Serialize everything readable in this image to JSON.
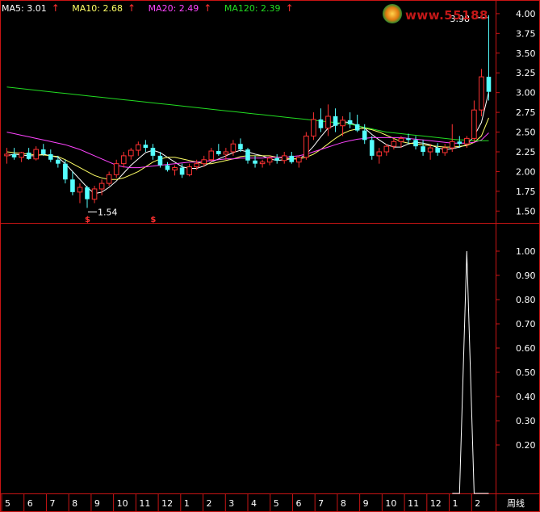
{
  "legend": {
    "ma5": {
      "label": "MA5: 3.01",
      "color": "#ffffff"
    },
    "ma10": {
      "label": "MA10: 2.68",
      "color": "#ffff66"
    },
    "ma20": {
      "label": "MA20: 2.49",
      "color": "#ff44ff"
    },
    "ma120": {
      "label": "MA120: 2.39",
      "color": "#22dd22"
    },
    "arrow": "↑"
  },
  "watermark": {
    "text": "www.55188"
  },
  "annotations": {
    "high": "3.98",
    "low": "1.54",
    "signal_marks": [
      "$",
      "$"
    ]
  },
  "period_label": "周线",
  "chart_data": [
    {
      "type": "candlestick",
      "name": "weekly-kline",
      "ylim": [
        1.35,
        4.05
      ],
      "yticks": [
        "1.50",
        "1.75",
        "2.00",
        "2.25",
        "2.50",
        "2.75",
        "3.00",
        "3.25",
        "3.50",
        "3.75",
        "4.00"
      ],
      "candles_ohlc": [
        [
          2.2,
          2.3,
          2.1,
          2.22
        ],
        [
          2.22,
          2.3,
          2.15,
          2.18
        ],
        [
          2.18,
          2.25,
          2.12,
          2.24
        ],
        [
          2.24,
          2.3,
          2.15,
          2.16
        ],
        [
          2.16,
          2.32,
          2.14,
          2.28
        ],
        [
          2.28,
          2.35,
          2.2,
          2.22
        ],
        [
          2.22,
          2.28,
          2.12,
          2.15
        ],
        [
          2.15,
          2.2,
          2.05,
          2.1
        ],
        [
          2.1,
          2.15,
          1.85,
          1.9
        ],
        [
          1.9,
          2.0,
          1.7,
          1.74
        ],
        [
          1.74,
          1.85,
          1.6,
          1.8
        ],
        [
          1.8,
          1.82,
          1.54,
          1.65
        ],
        [
          1.65,
          1.82,
          1.6,
          1.78
        ],
        [
          1.78,
          1.9,
          1.7,
          1.85
        ],
        [
          1.85,
          2.0,
          1.82,
          1.96
        ],
        [
          1.96,
          2.15,
          1.92,
          2.1
        ],
        [
          2.1,
          2.25,
          2.05,
          2.2
        ],
        [
          2.2,
          2.3,
          2.15,
          2.27
        ],
        [
          2.27,
          2.38,
          2.2,
          2.34
        ],
        [
          2.34,
          2.4,
          2.25,
          2.3
        ],
        [
          2.3,
          2.35,
          2.15,
          2.2
        ],
        [
          2.2,
          2.25,
          2.05,
          2.08
        ],
        [
          2.08,
          2.12,
          2.0,
          2.02
        ],
        [
          2.02,
          2.08,
          1.95,
          2.05
        ],
        [
          2.05,
          2.1,
          1.92,
          1.96
        ],
        [
          1.96,
          2.1,
          1.94,
          2.06
        ],
        [
          2.06,
          2.15,
          2.02,
          2.1
        ],
        [
          2.1,
          2.2,
          2.06,
          2.15
        ],
        [
          2.15,
          2.3,
          2.12,
          2.26
        ],
        [
          2.26,
          2.35,
          2.2,
          2.22
        ],
        [
          2.22,
          2.3,
          2.15,
          2.25
        ],
        [
          2.25,
          2.4,
          2.2,
          2.35
        ],
        [
          2.35,
          2.42,
          2.25,
          2.28
        ],
        [
          2.28,
          2.3,
          2.1,
          2.14
        ],
        [
          2.14,
          2.2,
          2.05,
          2.1
        ],
        [
          2.1,
          2.15,
          2.05,
          2.12
        ],
        [
          2.12,
          2.2,
          2.08,
          2.17
        ],
        [
          2.17,
          2.22,
          2.1,
          2.14
        ],
        [
          2.14,
          2.25,
          2.1,
          2.2
        ],
        [
          2.2,
          2.25,
          2.1,
          2.12
        ],
        [
          2.12,
          2.2,
          2.05,
          2.18
        ],
        [
          2.18,
          2.5,
          2.15,
          2.45
        ],
        [
          2.45,
          2.75,
          2.4,
          2.66
        ],
        [
          2.66,
          2.8,
          2.5,
          2.55
        ],
        [
          2.55,
          2.85,
          2.45,
          2.7
        ],
        [
          2.7,
          2.8,
          2.5,
          2.58
        ],
        [
          2.58,
          2.7,
          2.45,
          2.65
        ],
        [
          2.65,
          2.75,
          2.55,
          2.6
        ],
        [
          2.6,
          2.72,
          2.5,
          2.52
        ],
        [
          2.52,
          2.6,
          2.35,
          2.4
        ],
        [
          2.4,
          2.45,
          2.15,
          2.2
        ],
        [
          2.2,
          2.3,
          2.1,
          2.25
        ],
        [
          2.25,
          2.35,
          2.2,
          2.32
        ],
        [
          2.32,
          2.42,
          2.28,
          2.38
        ],
        [
          2.38,
          2.45,
          2.3,
          2.42
        ],
        [
          2.42,
          2.48,
          2.35,
          2.4
        ],
        [
          2.4,
          2.45,
          2.28,
          2.32
        ],
        [
          2.32,
          2.4,
          2.2,
          2.25
        ],
        [
          2.25,
          2.35,
          2.15,
          2.3
        ],
        [
          2.3,
          2.36,
          2.2,
          2.24
        ],
        [
          2.24,
          2.35,
          2.2,
          2.3
        ],
        [
          2.3,
          2.6,
          2.25,
          2.38
        ],
        [
          2.38,
          2.45,
          2.3,
          2.35
        ],
        [
          2.35,
          2.45,
          2.3,
          2.42
        ],
        [
          2.42,
          2.9,
          2.38,
          2.78
        ],
        [
          2.78,
          3.3,
          2.7,
          3.2
        ],
        [
          3.2,
          3.98,
          2.9,
          3.01
        ]
      ],
      "ma_series": [
        {
          "name": "MA5",
          "values": [
            2.2,
            2.22,
            2.21,
            2.2,
            2.2,
            2.22,
            2.2,
            2.18,
            2.1,
            2.0,
            1.9,
            1.8,
            1.72,
            1.74,
            1.8,
            1.88,
            1.98,
            2.08,
            2.16,
            2.24,
            2.27,
            2.24,
            2.18,
            2.12,
            2.06,
            2.04,
            2.04,
            2.07,
            2.12,
            2.16,
            2.2,
            2.24,
            2.27,
            2.25,
            2.22,
            2.2,
            2.16,
            2.14,
            2.15,
            2.16,
            2.16,
            2.22,
            2.32,
            2.44,
            2.55,
            2.59,
            2.63,
            2.62,
            2.58,
            2.55,
            2.47,
            2.4,
            2.34,
            2.31,
            2.31,
            2.35,
            2.37,
            2.36,
            2.34,
            2.3,
            2.28,
            2.29,
            2.31,
            2.34,
            2.45,
            2.62,
            3.01
          ]
        },
        {
          "name": "MA10",
          "values": [
            2.25,
            2.24,
            2.23,
            2.22,
            2.21,
            2.21,
            2.2,
            2.19,
            2.15,
            2.1,
            2.05,
            2.0,
            1.95,
            1.92,
            1.9,
            1.9,
            1.92,
            1.96,
            2.0,
            2.06,
            2.12,
            2.16,
            2.18,
            2.18,
            2.16,
            2.14,
            2.12,
            2.1,
            2.1,
            2.12,
            2.14,
            2.16,
            2.19,
            2.2,
            2.2,
            2.2,
            2.2,
            2.18,
            2.17,
            2.16,
            2.16,
            2.18,
            2.22,
            2.28,
            2.35,
            2.42,
            2.48,
            2.52,
            2.54,
            2.55,
            2.53,
            2.5,
            2.46,
            2.42,
            2.38,
            2.36,
            2.35,
            2.34,
            2.33,
            2.32,
            2.31,
            2.31,
            2.32,
            2.33,
            2.37,
            2.45,
            2.68
          ]
        },
        {
          "name": "MA20",
          "values": [
            2.5,
            2.48,
            2.46,
            2.44,
            2.42,
            2.4,
            2.38,
            2.36,
            2.34,
            2.31,
            2.28,
            2.24,
            2.2,
            2.16,
            2.12,
            2.08,
            2.06,
            2.05,
            2.05,
            2.06,
            2.07,
            2.08,
            2.09,
            2.1,
            2.11,
            2.12,
            2.12,
            2.13,
            2.14,
            2.15,
            2.16,
            2.16,
            2.17,
            2.17,
            2.17,
            2.17,
            2.18,
            2.18,
            2.18,
            2.19,
            2.2,
            2.22,
            2.25,
            2.28,
            2.31,
            2.34,
            2.37,
            2.39,
            2.41,
            2.42,
            2.43,
            2.43,
            2.43,
            2.43,
            2.43,
            2.42,
            2.41,
            2.4,
            2.39,
            2.38,
            2.37,
            2.36,
            2.36,
            2.36,
            2.37,
            2.4,
            2.49
          ]
        },
        {
          "name": "MA120",
          "values": [
            3.07,
            3.06,
            3.05,
            3.04,
            3.03,
            3.02,
            3.01,
            3.0,
            2.99,
            2.98,
            2.97,
            2.96,
            2.95,
            2.94,
            2.93,
            2.92,
            2.91,
            2.9,
            2.89,
            2.88,
            2.87,
            2.86,
            2.85,
            2.84,
            2.83,
            2.82,
            2.81,
            2.8,
            2.79,
            2.78,
            2.77,
            2.76,
            2.75,
            2.74,
            2.73,
            2.72,
            2.71,
            2.7,
            2.69,
            2.68,
            2.67,
            2.66,
            2.65,
            2.64,
            2.63,
            2.62,
            2.61,
            2.6,
            2.58,
            2.56,
            2.54,
            2.52,
            2.5,
            2.49,
            2.48,
            2.47,
            2.46,
            2.45,
            2.44,
            2.43,
            2.42,
            2.41,
            2.4,
            2.4,
            2.39,
            2.39,
            2.39
          ]
        }
      ],
      "signal_indices": [
        11,
        20
      ]
    },
    {
      "type": "line",
      "name": "indicator",
      "ylim": [
        0,
        1.05
      ],
      "yticks": [
        "0.20",
        "0.30",
        "0.40",
        "0.50",
        "0.60",
        "0.70",
        "0.80",
        "0.90",
        "1.00"
      ],
      "x_index_range": [
        0,
        66
      ],
      "values_sparse": [
        [
          61,
          0
        ],
        [
          62,
          0
        ],
        [
          63,
          1.0
        ],
        [
          64,
          0
        ],
        [
          65,
          0
        ],
        [
          66,
          0
        ]
      ]
    }
  ],
  "x_axis": {
    "labels": [
      "5",
      "6",
      "7",
      "8",
      "9",
      "10",
      "11",
      "12",
      "1",
      "2",
      "3",
      "4",
      "5",
      "6",
      "7",
      "8",
      "9",
      "10",
      "11",
      "12",
      "1",
      "2"
    ],
    "period_label": "周线"
  }
}
